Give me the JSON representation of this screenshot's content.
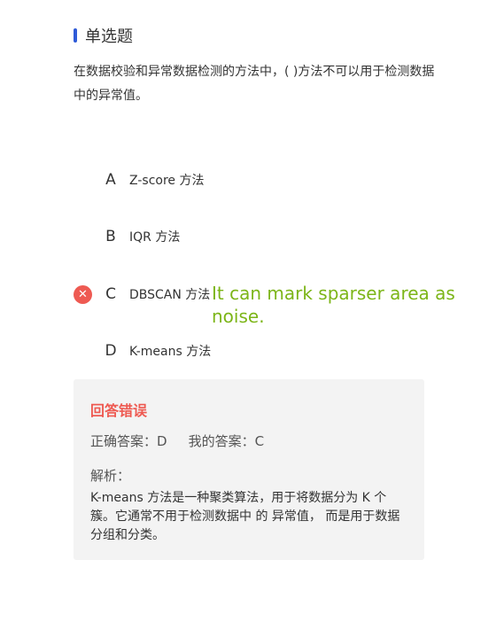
{
  "question_type": "单选题",
  "question_text": "在数据校验和异常数据检测的方法中，( )方法不可以用于检测数据中的异常值。",
  "options": [
    {
      "letter": "A",
      "text": "Z-score 方法"
    },
    {
      "letter": "B",
      "text": "IQR 方法"
    },
    {
      "letter": "C",
      "text": "DBSCAN 方法",
      "wrong_mark": "✕"
    },
    {
      "letter": "D",
      "text": "K-means 方法"
    }
  ],
  "annotation": "It can mark sparser area as noise.",
  "result": {
    "title": "回答错误",
    "correct_label": "正确答案：",
    "correct_value": "D",
    "my_label": "我的答案：",
    "my_value": "C",
    "analysis_label": "解析：",
    "analysis_text": "K-means 方法是一种聚类算法，用于将数据分为 K 个簇。它通常不用于检测数据中 的 异常值， 而是用于数据分组和分类。"
  },
  "colors": {
    "accent": "#2f5bd8",
    "error": "#ee5a52",
    "annotation": "#7cb518",
    "panel_bg": "#f3f3f3"
  }
}
